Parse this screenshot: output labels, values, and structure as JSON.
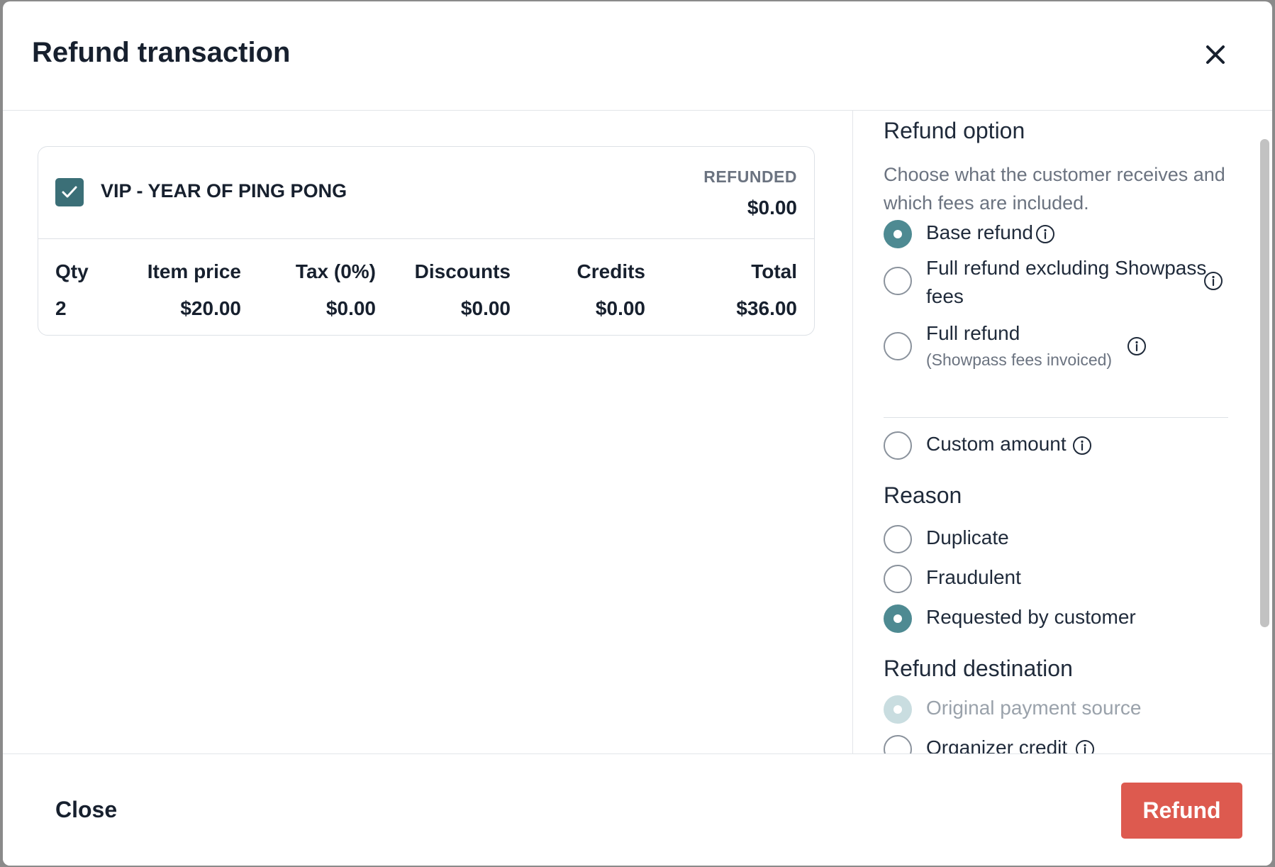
{
  "modal": {
    "title": "Refund transaction"
  },
  "item": {
    "name": "VIP - YEAR OF PING PONG",
    "checked": true,
    "refunded_label": "REFUNDED",
    "refunded_value": "$0.00",
    "columns": {
      "qty": {
        "header": "Qty",
        "value": "2"
      },
      "item_price": {
        "header": "Item price",
        "value": "$20.00"
      },
      "tax": {
        "header": "Tax (0%)",
        "value": "$0.00"
      },
      "discounts": {
        "header": "Discounts",
        "value": "$0.00"
      },
      "credits": {
        "header": "Credits",
        "value": "$0.00"
      },
      "total": {
        "header": "Total",
        "value": "$36.00"
      }
    }
  },
  "refund_option": {
    "title": "Refund option",
    "description": "Choose what the customer receives and which fees are included.",
    "options": [
      {
        "label": "Base refund",
        "selected": true
      },
      {
        "label_line1": "Full refund excluding Showpass",
        "label_line2": "fees",
        "selected": false
      },
      {
        "label": "Full refund",
        "sublabel": "(Showpass fees invoiced)",
        "selected": false
      },
      {
        "label": "Custom amount",
        "selected": false
      }
    ]
  },
  "reason": {
    "title": "Reason",
    "options": [
      {
        "label": "Duplicate",
        "selected": false
      },
      {
        "label": "Fraudulent",
        "selected": false
      },
      {
        "label": "Requested by customer",
        "selected": true
      }
    ]
  },
  "refund_destination": {
    "title": "Refund destination",
    "options": [
      {
        "label": "Original payment source",
        "selected": true,
        "disabled": true
      },
      {
        "label": "Organizer credit",
        "selected": false
      }
    ]
  },
  "footer": {
    "close_label": "Close",
    "refund_label": "Refund"
  },
  "colors": {
    "accent": "#4e8a92",
    "checkbox": "#3b6f77",
    "refund_button": "#dd5a4f"
  }
}
